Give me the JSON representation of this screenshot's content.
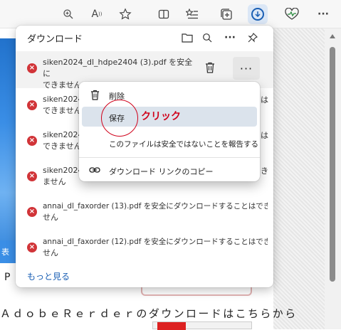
{
  "toolbar": {
    "icons": [
      "zoom-icon",
      "read-aloud-icon",
      "favorite-icon",
      "split-screen-icon",
      "favorites-list-icon",
      "collections-icon",
      "downloads-icon",
      "browser-essentials-icon",
      "more-icon"
    ],
    "read_aloud_glyph": "A",
    "more_glyph": "···"
  },
  "background": {
    "left_label": "表",
    "letter_p": "P",
    "bottom_text": "ＡｄｏｂｅＲｅｒｄｅｒのダウンロードはこちらから"
  },
  "downloads": {
    "title": "ダウンロード",
    "items": [
      {
        "name": "siken2024_dl_hdpe2404 (3).pdf を安全に",
        "name2": "できません"
      },
      {
        "name": "siken2024",
        "name2": "できません",
        "tail": "は"
      },
      {
        "name": "siken2024",
        "name2": "できません",
        "tail": "は"
      },
      {
        "name": "siken2024",
        "name2": "ません",
        "tail": "き"
      },
      {
        "name": "annai_dl_faxorder (13).pdf を安全にダウンロードすることはできま",
        "name2": "せん"
      },
      {
        "name": "annai_dl_faxorder (12).pdf を安全にダウンロードすることはできま",
        "name2": "せん"
      }
    ],
    "more_link": "もっと見る"
  },
  "context_menu": {
    "delete": "削除",
    "keep": "保存",
    "report": "このファイルは安全ではないことを報告する",
    "copy_link": "ダウンロード リンクのコピー"
  },
  "annotation": {
    "label": "クリック",
    "color": "#d0021b"
  },
  "colors": {
    "error": "#d13438",
    "link": "#1a5fb4",
    "highlight": "#dbe3ec"
  }
}
